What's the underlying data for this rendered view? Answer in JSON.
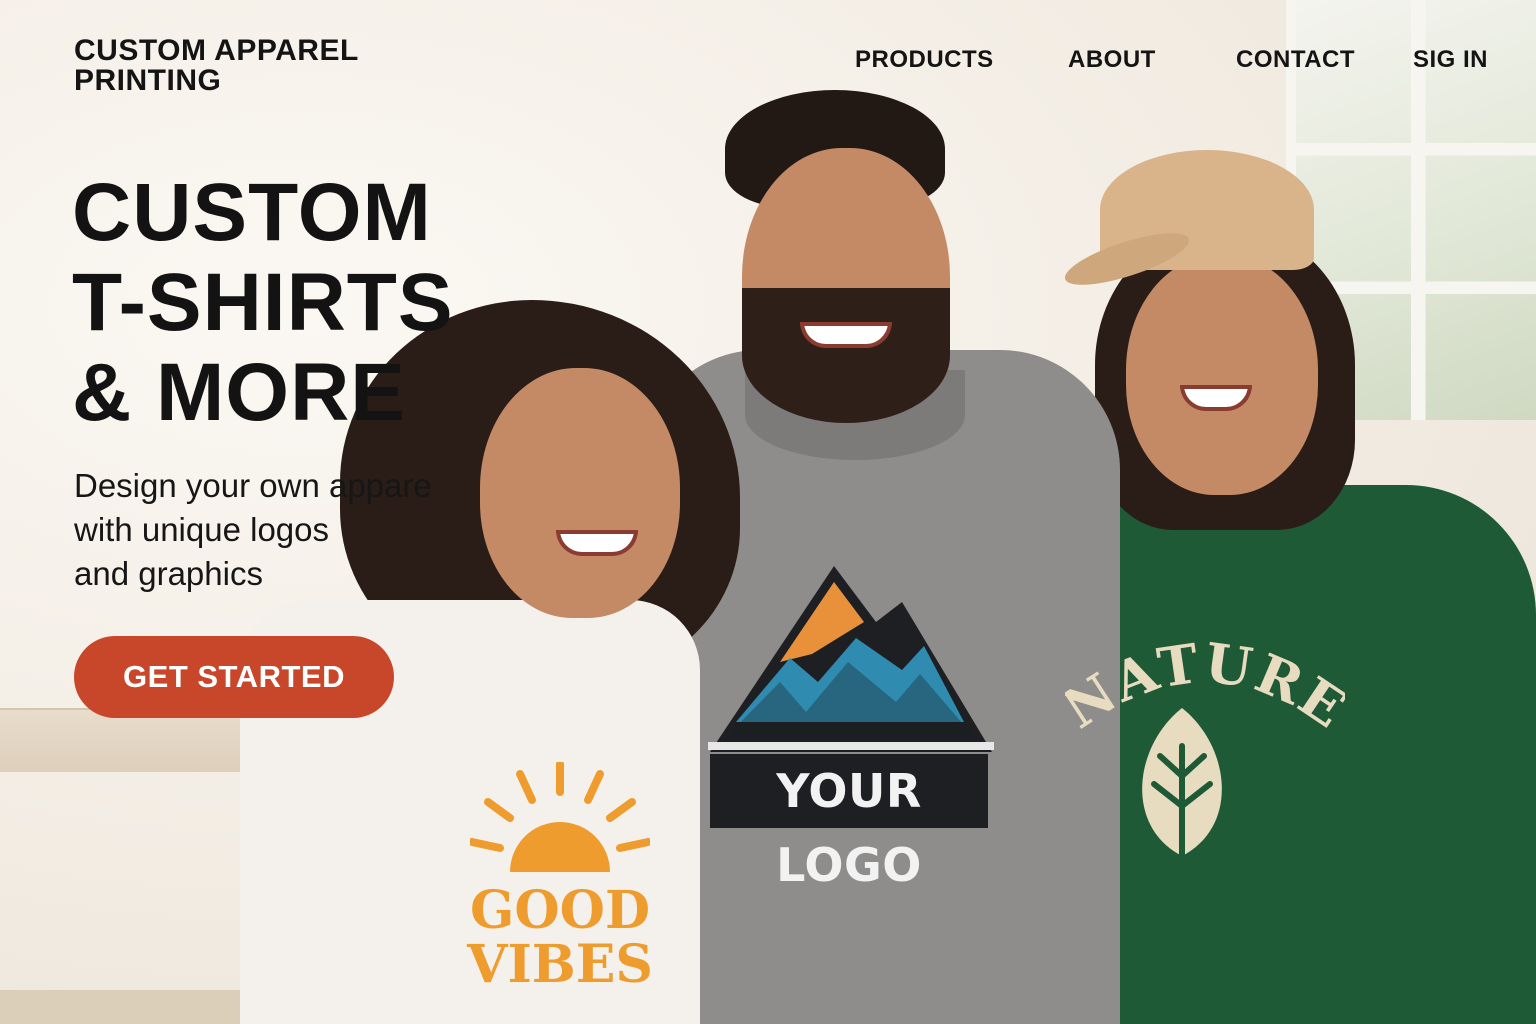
{
  "site": {
    "logo_line1": "CUSTOM APPAREL",
    "logo_line2": "PRINTING"
  },
  "nav": {
    "items": [
      {
        "label": "PRODUCTS"
      },
      {
        "label": "ABOUT"
      },
      {
        "label": "CONTACT"
      },
      {
        "label": "SIG IN"
      }
    ]
  },
  "hero": {
    "headline_line1": "CUSTOM",
    "headline_line2": "T-SHIRTS",
    "headline_line3": "& MORE",
    "sub_line1": "Design your own appare",
    "sub_line2": "with unique logos",
    "sub_line3": "and graphics",
    "cta_label": "GET STARTED"
  },
  "graphics": {
    "tee_line1": "GOOD",
    "tee_line2": "VIBES",
    "hoodie_text": "YOUR LOGO",
    "sweatshirt_text": "NATURE"
  },
  "colors": {
    "cta": "#c8472a",
    "headline": "#131313",
    "sun_orange": "#ef9c2f",
    "sweatshirt_green": "#1f5a37",
    "hoodie_gray": "#8e8d8b",
    "mountain_orange": "#e9913a",
    "mountain_blue": "#2f8bb0"
  }
}
